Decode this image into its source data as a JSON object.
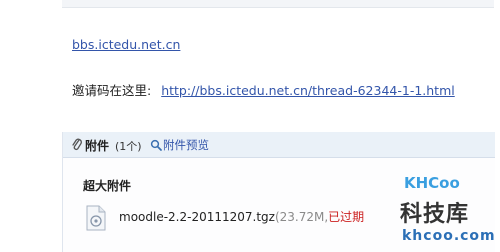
{
  "post": {
    "forum_link": "bbs.ictedu.net.cn",
    "invite_label": "邀请码在这里:",
    "invite_link": "http://bbs.ictedu.net.cn/thread-62344-1-1.html"
  },
  "attachments": {
    "title": "附件",
    "count": "(1个)",
    "preview_label": "附件预览",
    "section_label": "超大附件",
    "file": {
      "name": "moodle-2.2-20111207.tgz",
      "size": "(23.72M,",
      "status": "已过期"
    }
  },
  "watermark": {
    "badge": "KHCoo",
    "cn_text": "科技库",
    "url": "khcoo.com"
  },
  "colors": {
    "link": "#3355aa",
    "header_bg": "#eaf1f8",
    "expired": "#cc2222"
  }
}
